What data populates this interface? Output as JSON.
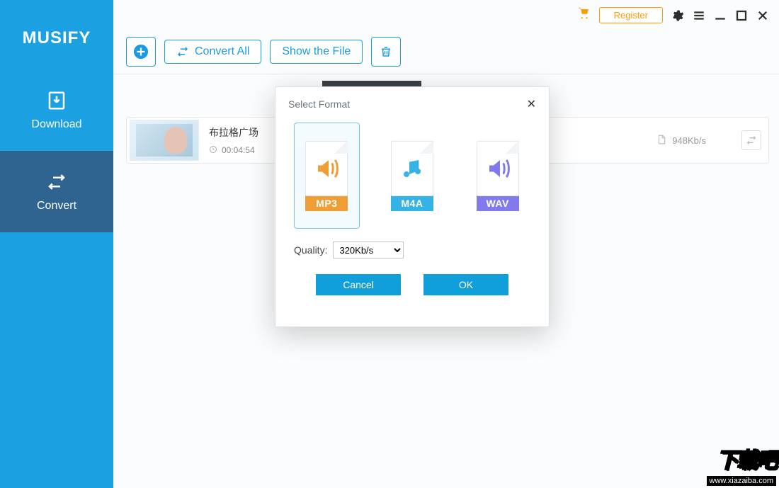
{
  "app": {
    "name": "MUSIFY"
  },
  "topbar": {
    "register": "Register"
  },
  "sidebar": {
    "download": "Download",
    "convert": "Convert"
  },
  "toolbar": {
    "convert_all": "Convert All",
    "show_file": "Show the File"
  },
  "file": {
    "title": "布拉格广场",
    "duration": "00:04:54",
    "bitrate": "948Kb/s"
  },
  "modal": {
    "title": "Select Format",
    "formats": {
      "mp3": "MP3",
      "m4a": "M4A",
      "wav": "WAV"
    },
    "quality_label": "Quality:",
    "quality_value": "320Kb/s",
    "cancel": "Cancel",
    "ok": "OK"
  },
  "watermark": {
    "zh": "下载吧",
    "url": "www.xiazaiba.com"
  }
}
